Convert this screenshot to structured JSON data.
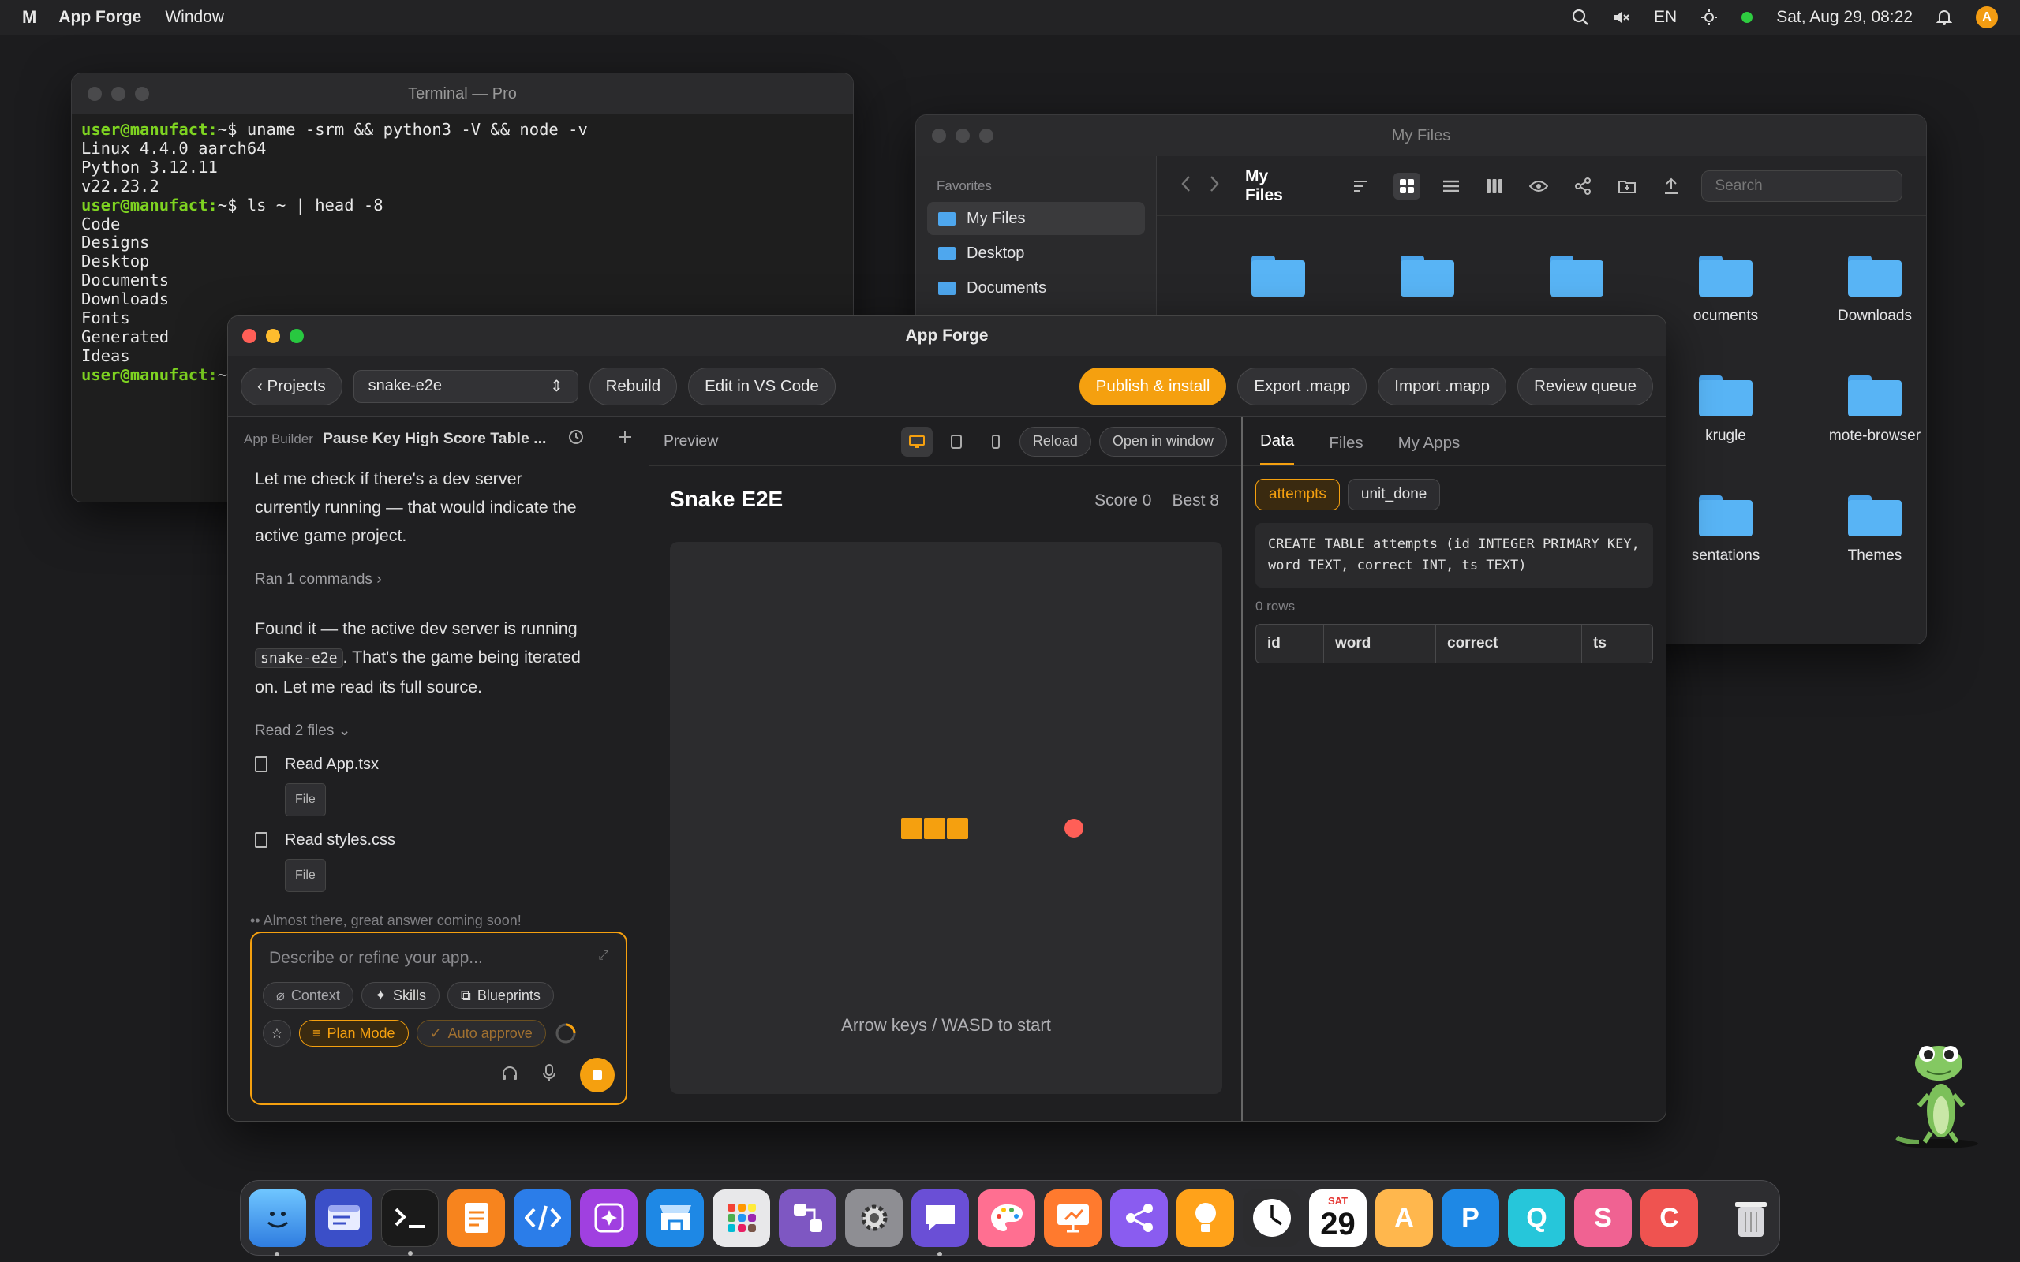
{
  "menubar": {
    "logo": "M",
    "app_name": "App Forge",
    "menu_window": "Window",
    "lang": "EN",
    "datetime": "Sat, Aug 29, 08:22",
    "avatar": "A"
  },
  "terminal": {
    "title": "Terminal — Pro",
    "prompt": "user@manufact:",
    "lines": [
      {
        "prompt": true,
        "cmd": "~$ uname -srm && python3 -V && node -v"
      },
      {
        "text": "Linux 4.4.0 aarch64"
      },
      {
        "text": "Python 3.12.11"
      },
      {
        "text": "v22.23.2"
      },
      {
        "prompt": true,
        "cmd": "~$ ls ~ | head -8"
      },
      {
        "text": "Code"
      },
      {
        "text": "Designs"
      },
      {
        "text": "Desktop"
      },
      {
        "text": "Documents"
      },
      {
        "text": "Downloads"
      },
      {
        "text": "Fonts"
      },
      {
        "text": "Generated"
      },
      {
        "text": "Ideas"
      },
      {
        "prompt": true,
        "cmd": "~"
      }
    ]
  },
  "files": {
    "title": "My Files",
    "favorites_label": "Favorites",
    "sidebar": [
      "My Files",
      "Desktop",
      "Documents"
    ],
    "toolbar_title": "My Files",
    "search_placeholder": "Search",
    "folders": [
      "",
      "",
      "",
      "ocuments",
      "Downloads",
      "krugle",
      "mote-browser",
      "sentations",
      "Themes"
    ]
  },
  "forge": {
    "title": "App Forge",
    "projects": "‹ Projects",
    "project_select": "snake-e2e",
    "rebuild": "Rebuild",
    "edit_vscode": "Edit in VS Code",
    "publish": "Publish & install",
    "export": "Export .mapp",
    "import": "Import .mapp",
    "review": "Review queue",
    "left": {
      "caption": "App Builder",
      "chat_title": "Pause Key High Score Table ...",
      "msg1": "Let me check if there's a dev server currently running — that would indicate the active game project.",
      "ran": "Ran 1 commands",
      "msg2_a": "Found it — the active dev server is running",
      "msg2_code": "snake-e2e",
      "msg2_b": ". That's the game being iterated on. Let me read its full source.",
      "read_files": "Read 2 files",
      "file1": "Read App.tsx",
      "file2": "Read styles.css",
      "file_chip": "File",
      "thinking": "Almost there, great answer coming soon!",
      "composer_placeholder": "Describe or refine your app...",
      "context": "Context",
      "skills": "Skills",
      "blueprints": "Blueprints",
      "plan_mode": "Plan Mode",
      "auto_approve": "Auto approve"
    },
    "preview": {
      "label": "Preview",
      "reload": "Reload",
      "open_window": "Open in window",
      "game_title": "Snake E2E",
      "score": "Score 0",
      "best": "Best 8",
      "hint": "Arrow keys / WASD to start"
    },
    "right": {
      "tabs": [
        "Data",
        "Files",
        "My Apps"
      ],
      "tables": [
        "attempts",
        "unit_done"
      ],
      "sql": "CREATE TABLE attempts (id INTEGER PRIMARY KEY, word TEXT, correct INT, ts TEXT)",
      "rows": "0 rows",
      "columns": [
        "id",
        "word",
        "correct",
        "ts"
      ]
    }
  },
  "dock": {
    "calendar_month": "SAT",
    "calendar_day": "29",
    "letters": [
      "A",
      "P",
      "Q",
      "S",
      "C"
    ]
  },
  "colors": {
    "accent": "#f5a00f",
    "folder": "#58b4f5",
    "prompt": "#7ed321",
    "food": "#ff5f57"
  }
}
